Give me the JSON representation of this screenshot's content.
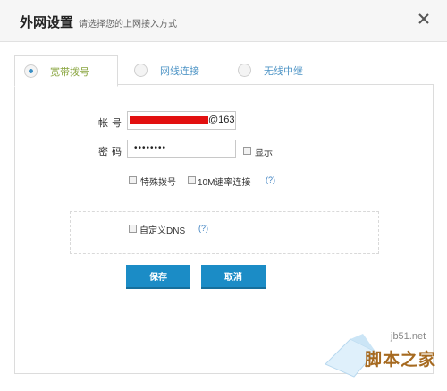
{
  "dialog": {
    "title": "外网设置",
    "subtitle": "请选择您的上网接入方式",
    "close_icon": "close-icon"
  },
  "tabs": [
    {
      "label": "宽带拨号",
      "selected": true
    },
    {
      "label": "网线连接",
      "selected": false
    },
    {
      "label": "无线中继",
      "selected": false
    }
  ],
  "form": {
    "account_label": "帐号",
    "account_suffix": "@163",
    "password_label": "密码",
    "password_mask": "••••••••",
    "show_label": "显示",
    "special_dial_label": "特殊拨号",
    "rate_label": "10M速率连接",
    "help_text": "(?)",
    "custom_dns_label": "自定义DNS"
  },
  "buttons": {
    "save": "保存",
    "cancel": "取消"
  },
  "watermark": {
    "site": "jb51.net",
    "brand": "脚本之家"
  },
  "colors": {
    "accent": "#1b8cc6",
    "redaction": "#e21010",
    "active_tab": "#8aa640",
    "tab_text": "#4f95c6"
  }
}
